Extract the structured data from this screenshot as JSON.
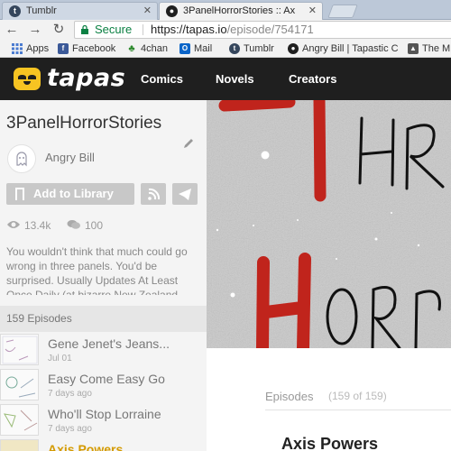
{
  "browser": {
    "tabs": [
      {
        "title": "Tumblr",
        "favicon": "tumblr-icon",
        "active": false
      },
      {
        "title": "3PanelHorrorStories :: Ax",
        "favicon": "tapas-icon",
        "active": true
      }
    ],
    "address": {
      "secure_label": "Secure",
      "url_host": "https://tapas.io",
      "url_path": "/episode/754171"
    },
    "bookmarks": [
      {
        "label": "Apps",
        "icon": "apps-grid-icon"
      },
      {
        "label": "Facebook",
        "icon": "facebook-icon"
      },
      {
        "label": "4chan",
        "icon": "clover-icon"
      },
      {
        "label": "Mail",
        "icon": "outlook-icon"
      },
      {
        "label": "Tumblr",
        "icon": "tumblr-icon"
      },
      {
        "label": "Angry Bill | Tapastic C",
        "icon": "tapas-icon"
      },
      {
        "label": "The M",
        "icon": "bookmark-icon"
      }
    ]
  },
  "site": {
    "logo_text": "tapas",
    "nav": [
      "Comics",
      "Novels",
      "Creators"
    ]
  },
  "series": {
    "title": "3PanelHorrorStories",
    "author": "Angry Bill",
    "add_library_label": "Add to Library",
    "views": "13.4k",
    "comments": "100",
    "description": "You wouldn't think that much could go wrong in three panels. You'd be surprised. Usually Updates At Least Once Daily (at bizarre New Zealand",
    "episode_count_label": "159 Episodes"
  },
  "episodes": [
    {
      "title": "Gene Jenet's Jeans...",
      "date": "Jul 01"
    },
    {
      "title": "Easy Come Easy Go",
      "date": "7 days ago"
    },
    {
      "title": "Who'll Stop Lorraine",
      "date": "7 days ago"
    },
    {
      "title": "Axis Powers",
      "date": ""
    }
  ],
  "right": {
    "episodes_label": "Episodes",
    "episodes_count": "(159 of 159)",
    "current_episode_title": "Axis Powers"
  },
  "colors": {
    "nav_bg": "#1f1f1f",
    "brand_yellow": "#f7c422",
    "secure_green": "#0b8043",
    "art_red": "#c0241c"
  }
}
